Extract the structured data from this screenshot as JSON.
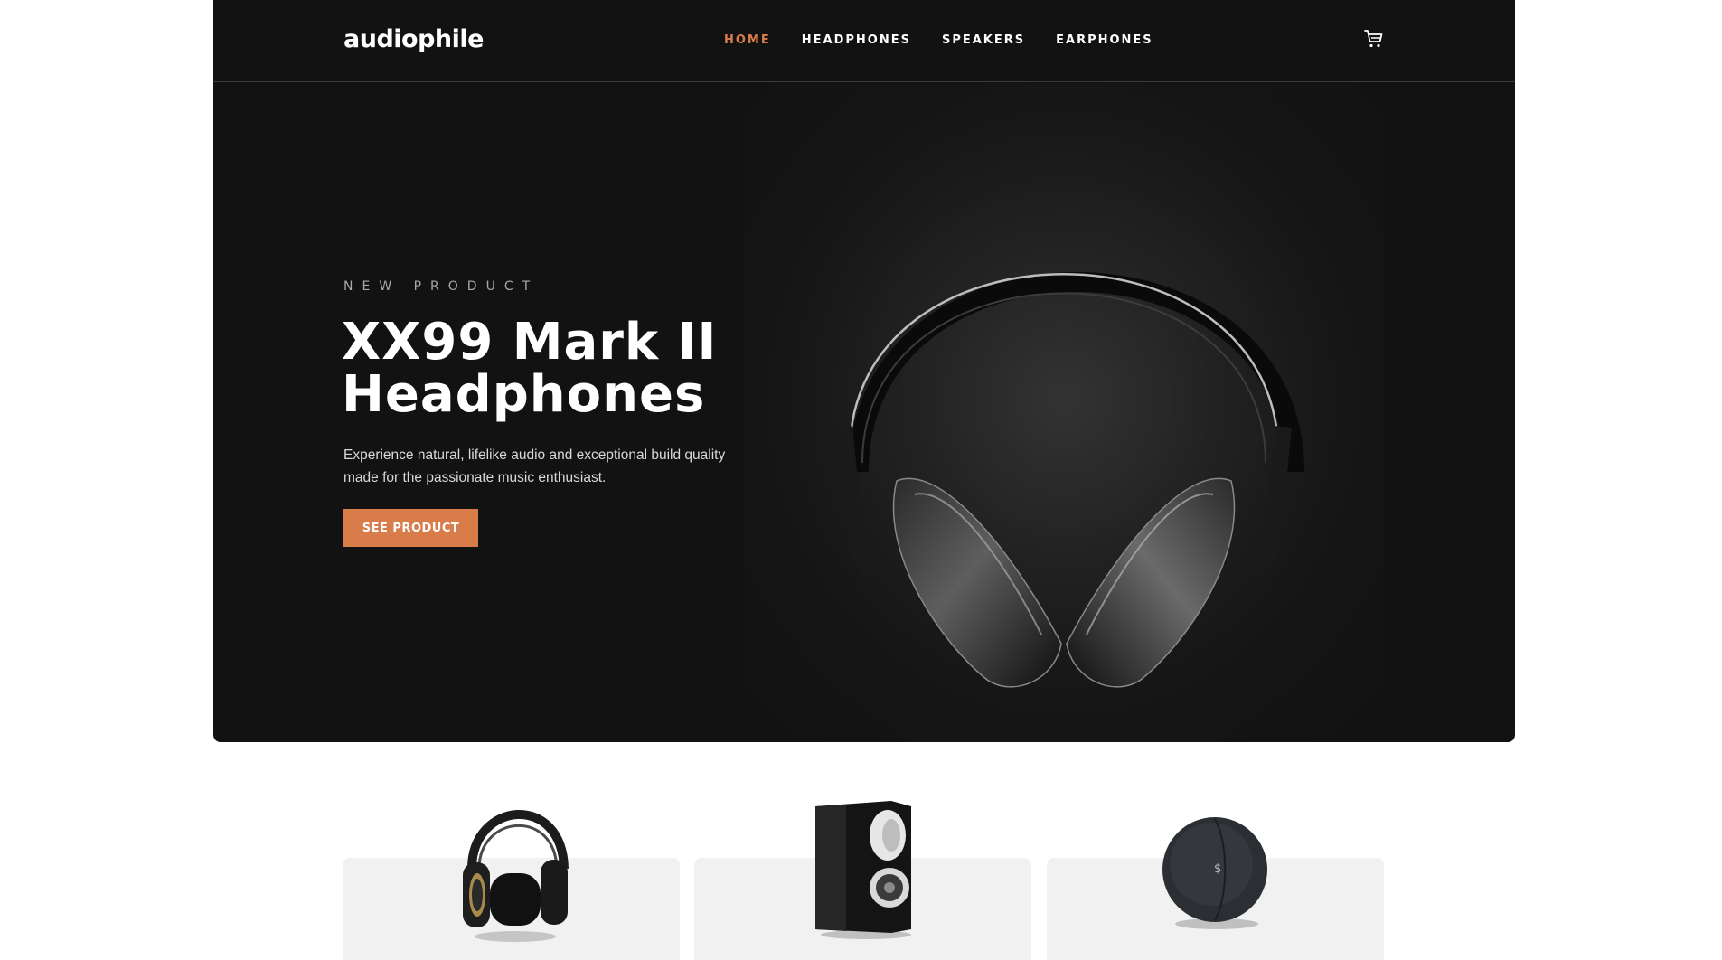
{
  "header": {
    "logo": "audiophile",
    "nav": [
      {
        "label": "HOME",
        "active": true
      },
      {
        "label": "HEADPHONES",
        "active": false
      },
      {
        "label": "SPEAKERS",
        "active": false
      },
      {
        "label": "EARPHONES",
        "active": false
      }
    ],
    "cart_icon": "cart-icon"
  },
  "hero": {
    "overline": "NEW PRODUCT",
    "title_line1": "XX99 Mark II",
    "title_line2": "Headphones",
    "description": "Experience natural, lifelike audio and exceptional build quality made for the passionate music enthusiast.",
    "cta_label": "SEE PRODUCT",
    "image": "headphones-hero-image"
  },
  "categories": [
    {
      "image": "headphones-thumbnail"
    },
    {
      "image": "speaker-thumbnail"
    },
    {
      "image": "earphones-case-thumbnail"
    }
  ],
  "colors": {
    "accent": "#d87d4a",
    "dark": "#121212",
    "card": "#f1f1f1"
  }
}
